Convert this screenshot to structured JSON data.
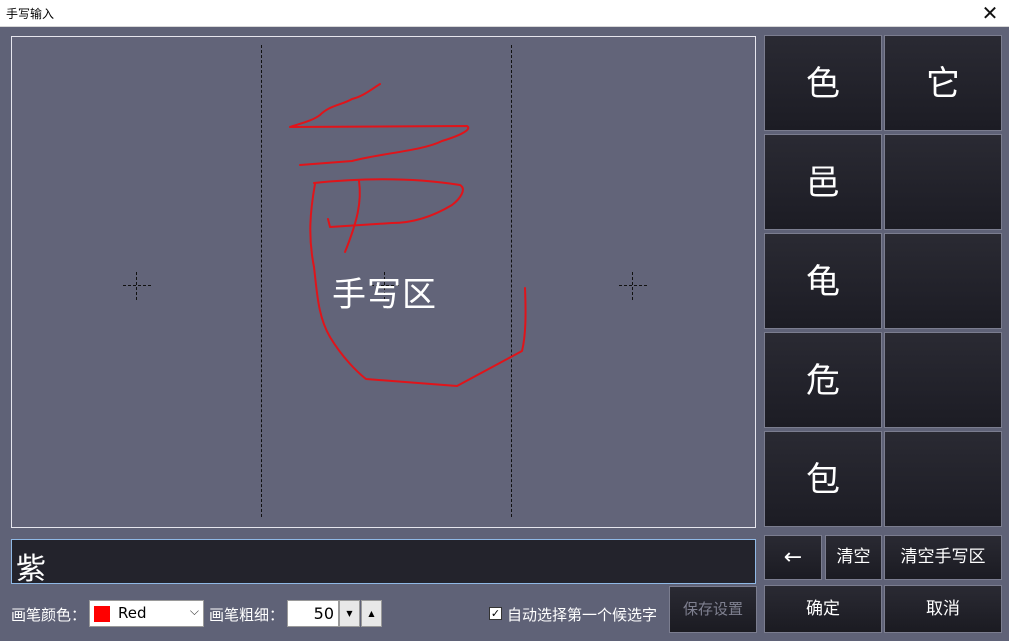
{
  "window": {
    "title": "手写输入",
    "close_icon": "close-icon"
  },
  "pad": {
    "label": "手写区",
    "ink_color": "#e0141a"
  },
  "result": {
    "text": "紫"
  },
  "candidates": [
    "色",
    "它",
    "邑",
    "",
    "龟",
    "",
    "危",
    "",
    "包",
    ""
  ],
  "actions": {
    "backspace": "←",
    "clear": "清空",
    "clear_pad": "清空手写区",
    "ok": "确定",
    "cancel": "取消"
  },
  "settings": {
    "pen_color_label": "画笔颜色：",
    "pen_color_value": "Red",
    "pen_color_hex": "#ff0000",
    "pen_width_label": "画笔粗细：",
    "pen_width_value": "50",
    "auto_select_label": "自动选择第一个候选字",
    "auto_select_checked": true,
    "save_label": "保存设置"
  }
}
